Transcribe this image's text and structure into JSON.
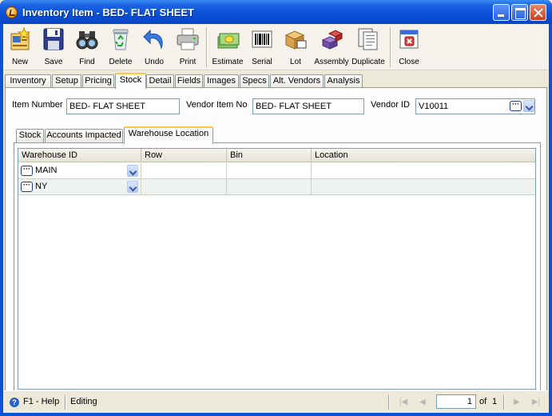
{
  "window": {
    "title": "Inventory Item - BED- FLAT SHEET"
  },
  "toolbar": {
    "buttons": [
      {
        "label": "New",
        "icon": "new-record-icon"
      },
      {
        "label": "Save",
        "icon": "floppy-disk-icon"
      },
      {
        "label": "Find",
        "icon": "binoculars-icon"
      },
      {
        "label": "Delete",
        "icon": "recycle-bin-icon"
      },
      {
        "label": "Undo",
        "icon": "undo-arrow-icon"
      },
      {
        "label": "Print",
        "icon": "printer-icon"
      },
      {
        "label": "Estimate",
        "icon": "money-stack-icon"
      },
      {
        "label": "Serial",
        "icon": "barcode-icon"
      },
      {
        "label": "Lot",
        "icon": "boxes-icon"
      },
      {
        "label": "Assembly",
        "icon": "assembly-blocks-icon"
      },
      {
        "label": "Duplicate",
        "icon": "duplicate-pages-icon"
      },
      {
        "label": "Close",
        "icon": "close-window-icon"
      }
    ]
  },
  "tabs": [
    {
      "label": "Inventory"
    },
    {
      "label": "Setup"
    },
    {
      "label": "Pricing"
    },
    {
      "label": "Stock",
      "active": true
    },
    {
      "label": "Detail"
    },
    {
      "label": "Fields"
    },
    {
      "label": "Images"
    },
    {
      "label": "Specs"
    },
    {
      "label": "Alt. Vendors"
    },
    {
      "label": "Analysis"
    }
  ],
  "form": {
    "item_number_label": "Item Number",
    "item_number_value": "BED- FLAT SHEET",
    "vendor_item_no_label": "Vendor Item No",
    "vendor_item_no_value": "BED- FLAT SHEET",
    "vendor_id_label": "Vendor ID",
    "vendor_id_value": "V10011"
  },
  "subtabs": [
    {
      "label": "Stock"
    },
    {
      "label": "Accounts Impacted"
    },
    {
      "label": "Warehouse Location",
      "active": true
    }
  ],
  "grid": {
    "columns": [
      "Warehouse ID",
      "Row",
      "Bin",
      "Location"
    ],
    "rows": [
      {
        "warehouse_id": "MAIN",
        "row": "",
        "bin": "",
        "location": ""
      },
      {
        "warehouse_id": "NY",
        "row": "",
        "bin": "",
        "location": ""
      }
    ]
  },
  "status": {
    "help": "F1 - Help",
    "mode": "Editing",
    "page_current": "1",
    "page_of_label": "of",
    "page_total": "1"
  },
  "colors": {
    "titlebar": "#0a4fd6",
    "active_tab_accent": "#ffc83c",
    "grid_row_alt": "#eef3f0"
  }
}
